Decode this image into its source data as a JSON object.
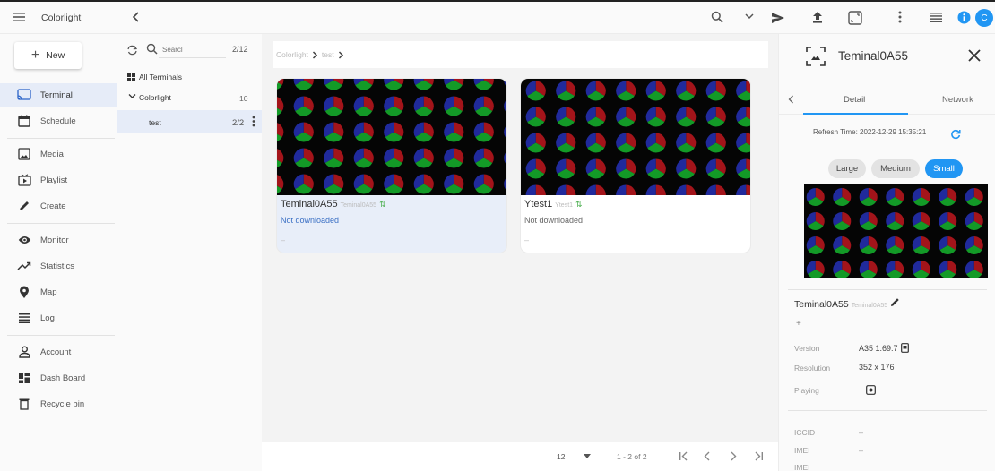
{
  "topbar": {
    "app_title": "Colorlight",
    "avatar_letter": "C",
    "colors": {
      "accent": "#2196f3"
    }
  },
  "leftnav": {
    "new_label": "New",
    "items": [
      {
        "label": "Terminal",
        "icon": "cast-icon",
        "active": true
      },
      {
        "label": "Schedule",
        "icon": "calendar-icon"
      },
      {
        "label": "Media",
        "icon": "image-icon"
      },
      {
        "label": "Playlist",
        "icon": "playlist-icon"
      },
      {
        "label": "Create",
        "icon": "pencil-icon"
      },
      {
        "label": "Monitor",
        "icon": "eye-icon"
      },
      {
        "label": "Statistics",
        "icon": "trend-icon"
      },
      {
        "label": "Map",
        "icon": "map-pin-icon"
      },
      {
        "label": "Log",
        "icon": "log-icon"
      },
      {
        "label": "Account",
        "icon": "person-icon"
      },
      {
        "label": "Dash Board",
        "icon": "dashboard-icon"
      },
      {
        "label": "Recycle bin",
        "icon": "trash-icon"
      }
    ]
  },
  "tree": {
    "search_placeholder": "Searcl",
    "count": "2/12",
    "all_label": "All Terminals",
    "group": {
      "name": "Colorlight",
      "count": "10"
    },
    "sub": {
      "name": "test",
      "count": "2/2"
    }
  },
  "main": {
    "breadcrumb": [
      "Colorlight",
      "test"
    ],
    "cards": [
      {
        "name": "Teminal0A55",
        "alias": "Teminal0A55",
        "status": "Not downloaded",
        "dash": "–",
        "selected": true
      },
      {
        "name": "Ytest1",
        "alias": "Ytest1",
        "status": "Not downloaded",
        "dash": "–",
        "selected": false
      }
    ],
    "pager": {
      "page_size": "12",
      "range": "1 - 2 of 2"
    }
  },
  "detail": {
    "title": "Teminal0A55",
    "tabs": [
      "Detail",
      "Network"
    ],
    "refresh_text": "Refresh Time: 2022-12-29 15:35:21",
    "sizes": [
      "Large",
      "Medium",
      "Small"
    ],
    "selected_size": "Small",
    "name": "Teminal0A55",
    "alias": "Teminal0A55",
    "plus": "+",
    "fields": [
      {
        "key": "Version",
        "value": "A35 1.69.7"
      },
      {
        "key": "Resolution",
        "value": "352 x 176"
      },
      {
        "key": "Playing",
        "value": ""
      }
    ],
    "fields2": [
      {
        "key": "ICCID",
        "value": "–"
      },
      {
        "key": "IMEI",
        "value": "–"
      },
      {
        "key": "IMEI",
        "value": ""
      }
    ]
  }
}
